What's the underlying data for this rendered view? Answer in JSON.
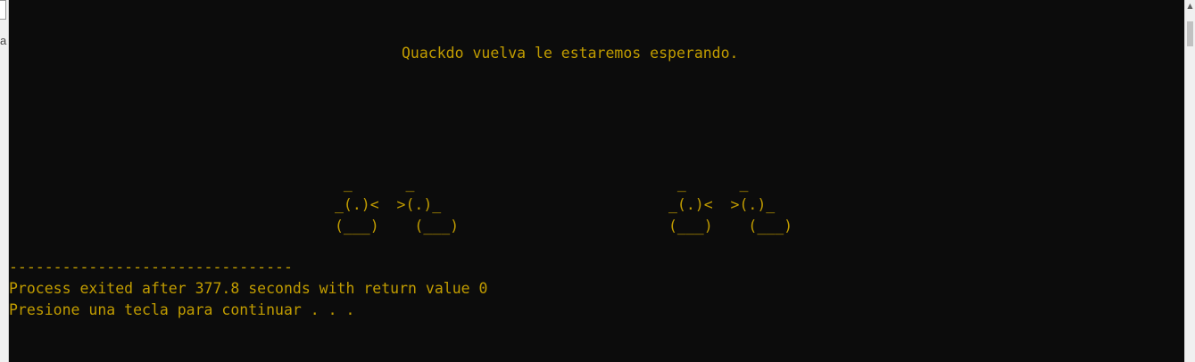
{
  "window": {
    "left_strip_glyph": "a"
  },
  "console": {
    "farewell": "Quackdo vuelva le estaremos esperando.",
    "ducks": [
      " _      _\n_(.)<  >(.)_\n(___)    (___)",
      " _      _\n_(.)<  >(.)_\n(___)    (___)"
    ],
    "separator": "--------------------------------",
    "process_status": "Process exited after 377.8 seconds with return value 0",
    "continue_prompt": "Presione una tecla para continuar . . ."
  },
  "colors": {
    "console_bg": "#0c0c0c",
    "console_text": "#c19c00"
  }
}
